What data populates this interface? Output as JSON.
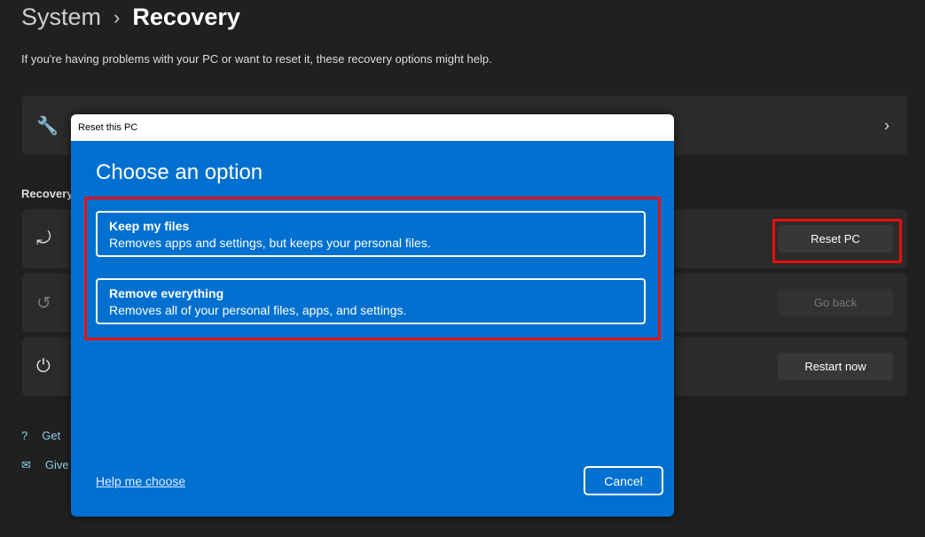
{
  "breadcrumb": {
    "parent": "System",
    "separator": "›",
    "current": "Recovery"
  },
  "description": "If you're having problems with your PC or want to reset it, these recovery options might help.",
  "section_title": "Recovery",
  "buttons": {
    "reset": "Reset PC",
    "go_back": "Go back",
    "restart": "Restart now"
  },
  "links": [
    "Get",
    "Give"
  ],
  "dialog": {
    "title": "Reset this PC",
    "heading": "Choose an option",
    "options": [
      {
        "title": "Keep my files",
        "desc": "Removes apps and settings, but keeps your personal files."
      },
      {
        "title": "Remove everything",
        "desc": "Removes all of your personal files, apps, and settings."
      }
    ],
    "help": "Help me choose",
    "cancel": "Cancel"
  },
  "colors": {
    "dialog_blue": "#0070d0",
    "highlight": "#e81010"
  }
}
